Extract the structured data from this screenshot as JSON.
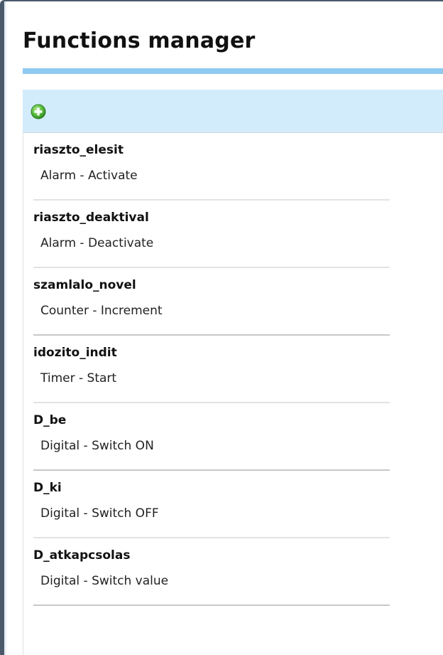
{
  "header": {
    "title": "Functions manager"
  },
  "toolbar": {
    "add_icon": "plus-circle-green-icon"
  },
  "functions": [
    {
      "name": "riaszto_elesit",
      "description": "Alarm - Activate"
    },
    {
      "name": "riaszto_deaktival",
      "description": "Alarm - Deactivate"
    },
    {
      "name": "szamlalo_novel",
      "description": "Counter - Increment"
    },
    {
      "name": "idozito_indit",
      "description": "Timer - Start"
    },
    {
      "name": "D_be",
      "description": "Digital - Switch ON"
    },
    {
      "name": "D_ki",
      "description": "Digital - Switch OFF"
    },
    {
      "name": "D_atkapcsolas",
      "description": "Digital - Switch value"
    }
  ],
  "colors": {
    "accent": "#8fcaf0",
    "toolbar_bg": "#d3ecfb",
    "add_icon": "#4caf3c"
  }
}
